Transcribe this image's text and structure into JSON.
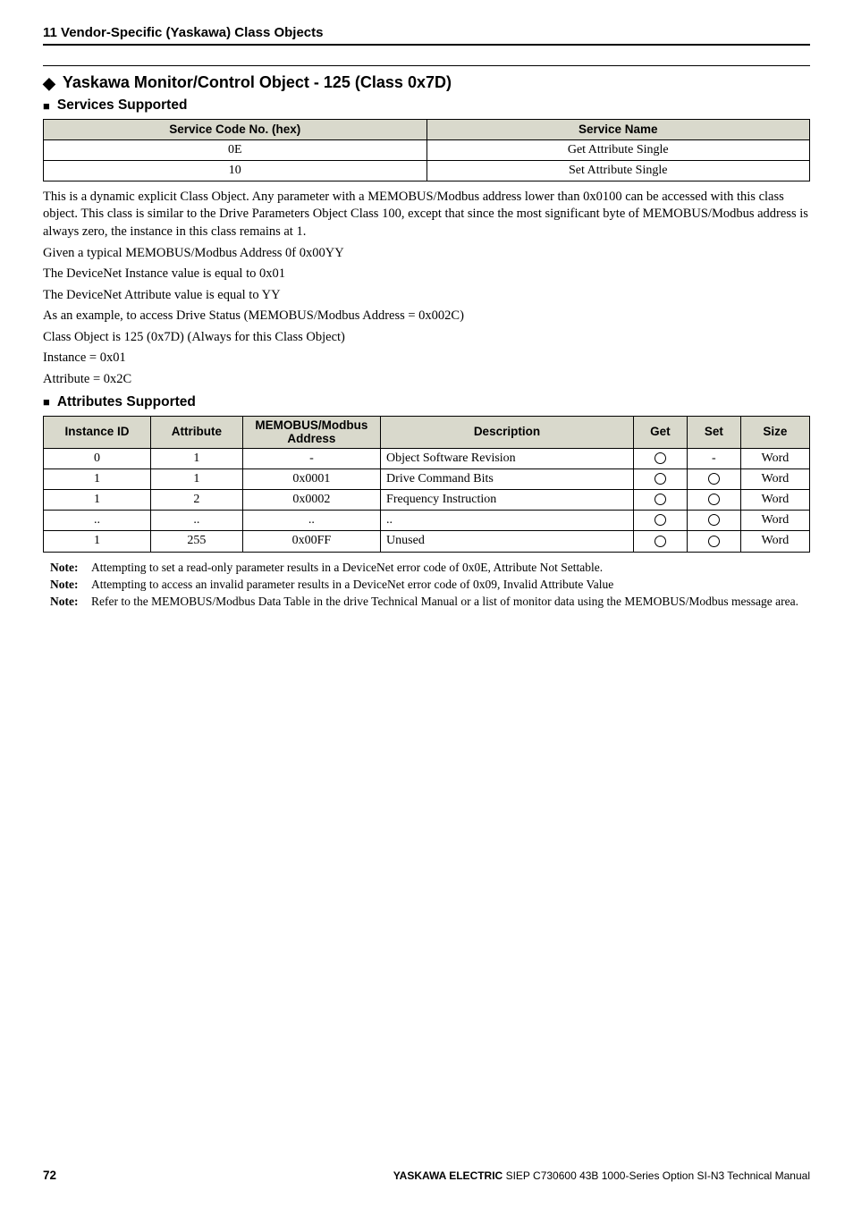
{
  "running_head": "11  Vendor-Specific (Yaskawa) Class Objects",
  "section_title": "Yaskawa Monitor/Control Object - 125 (Class 0x7D)",
  "services_heading": "Services Supported",
  "services_table": {
    "headers": [
      "Service Code No. (hex)",
      "Service Name"
    ],
    "rows": [
      {
        "code": "0E",
        "name": "Get Attribute Single"
      },
      {
        "code": "10",
        "name": "Set Attribute Single"
      }
    ]
  },
  "paragraphs": [
    "This is a dynamic explicit Class Object. Any parameter with a MEMOBUS/Modbus address lower than 0x0100 can be accessed with this class object. This class is similar to the Drive Parameters Object Class 100, except that since the most significant byte of MEMOBUS/Modbus address is always zero, the instance in this class remains at 1.",
    "Given a typical MEMOBUS/Modbus Address 0f 0x00YY",
    "The DeviceNet Instance value is equal to 0x01",
    "The DeviceNet Attribute value is equal to YY",
    "As an example, to access Drive Status (MEMOBUS/Modbus Address = 0x002C)",
    "Class Object is 125 (0x7D) (Always for this Class Object)",
    "Instance = 0x01",
    "Attribute = 0x2C"
  ],
  "attributes_heading": "Attributes Supported",
  "attributes_table": {
    "headers": [
      "Instance ID",
      "Attribute",
      "MEMOBUS/Modbus Address",
      "Description",
      "Get",
      "Set",
      "Size"
    ],
    "rows": [
      {
        "instance": "0",
        "attribute": "1",
        "address": "-",
        "description": "Object Software Revision",
        "get": "○",
        "set": "-",
        "size": "Word"
      },
      {
        "instance": "1",
        "attribute": "1",
        "address": "0x0001",
        "description": "Drive Command Bits",
        "get": "○",
        "set": "○",
        "size": "Word"
      },
      {
        "instance": "1",
        "attribute": "2",
        "address": "0x0002",
        "description": "Frequency Instruction",
        "get": "○",
        "set": "○",
        "size": "Word"
      },
      {
        "instance": "..",
        "attribute": "..",
        "address": "..",
        "description": "..",
        "get": "○",
        "set": "○",
        "size": "Word"
      },
      {
        "instance": "1",
        "attribute": "255",
        "address": "0x00FF",
        "description": "Unused",
        "get": "○",
        "set": "○",
        "size": "Word"
      }
    ]
  },
  "notes": [
    "Attempting to set a read-only parameter results in a DeviceNet error code of 0x0E, Attribute Not Settable.",
    "Attempting to access an invalid parameter results in a DeviceNet error code of 0x09, Invalid Attribute Value",
    "Refer to the MEMOBUS/Modbus Data Table in the drive Technical Manual or a list of monitor data using the MEMOBUS/Modbus message area."
  ],
  "note_label": "Note:",
  "footer": {
    "page": "72",
    "company": "YASKAWA ELECTRIC",
    "doc": " SIEP C730600 43B 1000-Series Option SI-N3 Technical Manual"
  },
  "chart_data": {
    "type": "table",
    "tables": [
      {
        "name": "Services Supported",
        "columns": [
          "Service Code No. (hex)",
          "Service Name"
        ],
        "rows": [
          [
            "0E",
            "Get Attribute Single"
          ],
          [
            "10",
            "Set Attribute Single"
          ]
        ]
      },
      {
        "name": "Attributes Supported",
        "columns": [
          "Instance ID",
          "Attribute",
          "MEMOBUS/Modbus Address",
          "Description",
          "Get",
          "Set",
          "Size"
        ],
        "rows": [
          [
            "0",
            "1",
            "-",
            "Object Software Revision",
            "yes",
            "-",
            "Word"
          ],
          [
            "1",
            "1",
            "0x0001",
            "Drive Command Bits",
            "yes",
            "yes",
            "Word"
          ],
          [
            "1",
            "2",
            "0x0002",
            "Frequency Instruction",
            "yes",
            "yes",
            "Word"
          ],
          [
            "..",
            "..",
            "..",
            "..",
            "yes",
            "yes",
            "Word"
          ],
          [
            "1",
            "255",
            "0x00FF",
            "Unused",
            "yes",
            "yes",
            "Word"
          ]
        ]
      }
    ]
  }
}
